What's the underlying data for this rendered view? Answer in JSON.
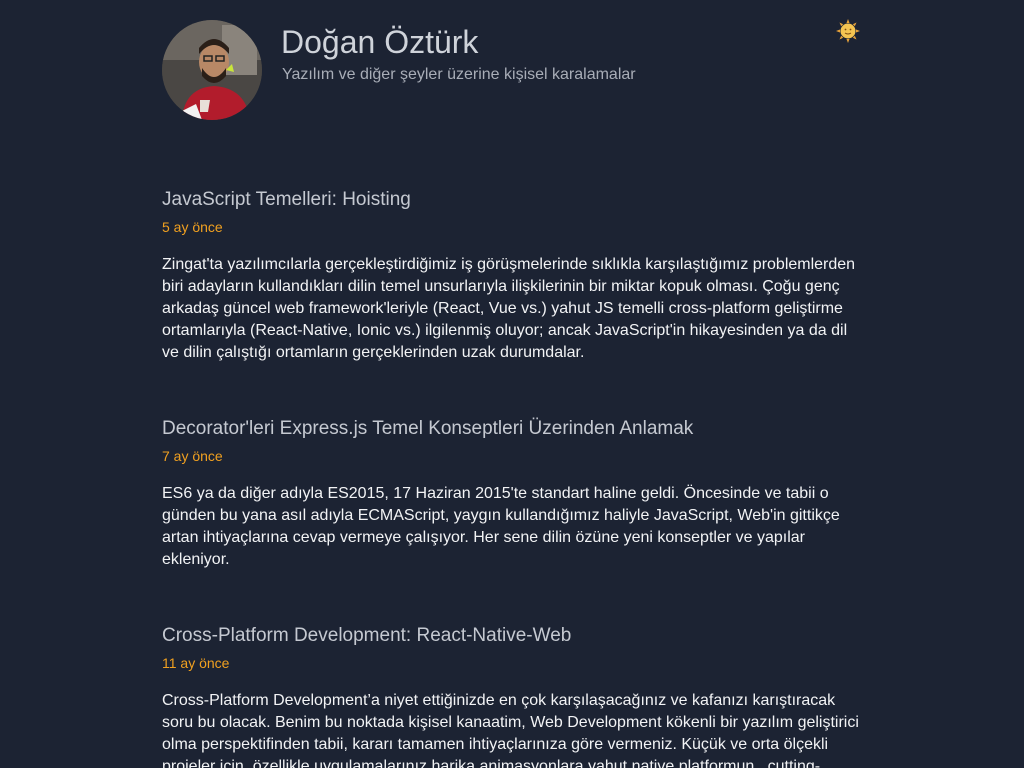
{
  "header": {
    "title": "Doğan Öztürk",
    "subtitle": "Yazılım ve diğer şeyler üzerine kişisel karalamalar",
    "avatar_icon": "profile-photo",
    "theme_icon": "sun-icon",
    "theme_color": "#f5b342"
  },
  "colors": {
    "background": "#1c2333",
    "date_accent": "#f0a020"
  },
  "posts": [
    {
      "title": "JavaScript Temelleri: Hoisting",
      "date": "5 ay önce",
      "excerpt": "Zingat'ta yazılımcılarla gerçekleştirdiğimiz iş görüşmelerinde sıklıkla karşılaştığımız problemlerden biri adayların kullandıkları dilin temel unsurlarıyla ilişkilerinin bir miktar kopuk olması. Çoğu genç arkadaş güncel web framework'leriyle (React, Vue vs.) yahut JS temelli cross-platform geliştirme ortamlarıyla (React-Native, Ionic vs.) ilgilenmiş oluyor; ancak JavaScript'in hikayesinden ya da dil ve dilin çalıştığı ortamların gerçeklerinden uzak durumdalar."
    },
    {
      "title": "Decorator'leri Express.js Temel Konseptleri Üzerinden Anlamak",
      "date": "7 ay önce",
      "excerpt": "ES6 ya da diğer adıyla ES2015, 17 Haziran 2015'te standart haline geldi. Öncesinde ve tabii o günden bu yana asıl adıyla ECMAScript, yaygın kullandığımız haliyle JavaScript, Web'in gittikçe artan ihtiyaçlarına cevap vermeye çalışıyor. Her sene dilin özüne yeni konseptler ve yapılar ekleniyor."
    },
    {
      "title": "Cross-Platform Development: React-Native-Web",
      "date": "11 ay önce",
      "excerpt": "Cross-Platform Development’a niyet ettiğinizde en çok karşılaşacağınız ve kafanızı karıştıracak soru bu olacak. Benim bu noktada kişisel kanaatim, Web Development kökenli bir yazılım geliştirici olma perspektifinden tabii, kararı tamamen ihtiyaçlarınıza göre vermeniz. Küçük ve orta ölçekli projeler için, özellikle uygulamalarınız harika animasyonlara yahut native platformun _cutting-"
    }
  ]
}
